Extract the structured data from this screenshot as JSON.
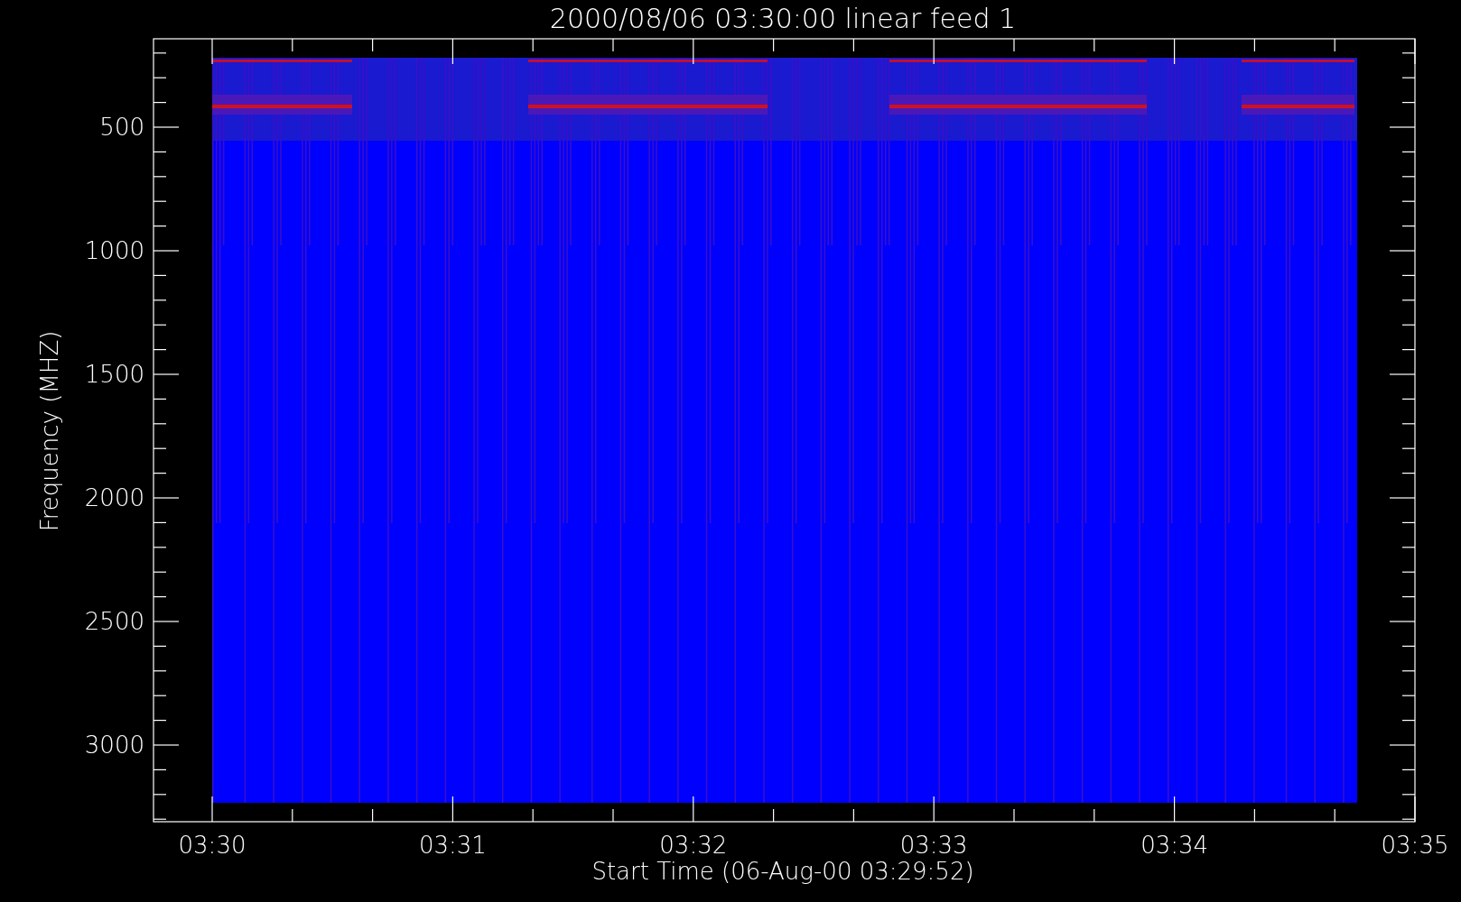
{
  "plot": {
    "title": "2000/08/06 03:30:00 linear feed 1",
    "xlabel": "Start Time (06-Aug-00 03:29:52)",
    "ylabel": "Frequency (MHZ)",
    "xticks": [
      "03:30",
      "03:31",
      "03:32",
      "03:33",
      "03:34",
      "03:35"
    ],
    "yticks": [
      "500",
      "1000",
      "1500",
      "2000",
      "2500",
      "3000"
    ]
  }
}
